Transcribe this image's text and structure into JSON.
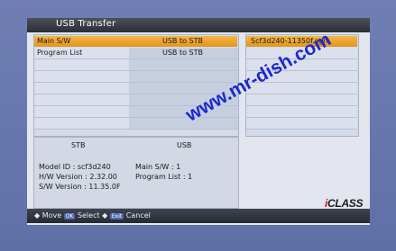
{
  "title": "USB Transfer",
  "list": {
    "rows": [
      {
        "label": "Main S/W",
        "value": "USB to STB"
      },
      {
        "label": "Program List",
        "value": "USB to STB"
      }
    ]
  },
  "files": {
    "selected": "Scf3d240-11350f.sgn"
  },
  "info": {
    "stb_header": "STB",
    "usb_header": "USB",
    "stb": {
      "model": "Model ID : scf3d240",
      "hw": "H/W Version : 2.32.00",
      "sw": "S/W Version : 11.35.0F"
    },
    "usb": {
      "main_sw": "Main S/W : 1",
      "program_list": "Program List : 1"
    }
  },
  "footer": {
    "move_label": "Move",
    "ok_key": "OK",
    "select_label": "Select",
    "exit_key": "Exit",
    "cancel_label": "Cancel"
  },
  "watermark": "www.mr-dish.com",
  "logo": {
    "prefix": "i",
    "suffix": "CLASS"
  },
  "colors": {
    "background": "#6f7fb4",
    "highlight": "#f0a62e",
    "panel": "#d5dce9",
    "watermark": "#1d27d6"
  }
}
